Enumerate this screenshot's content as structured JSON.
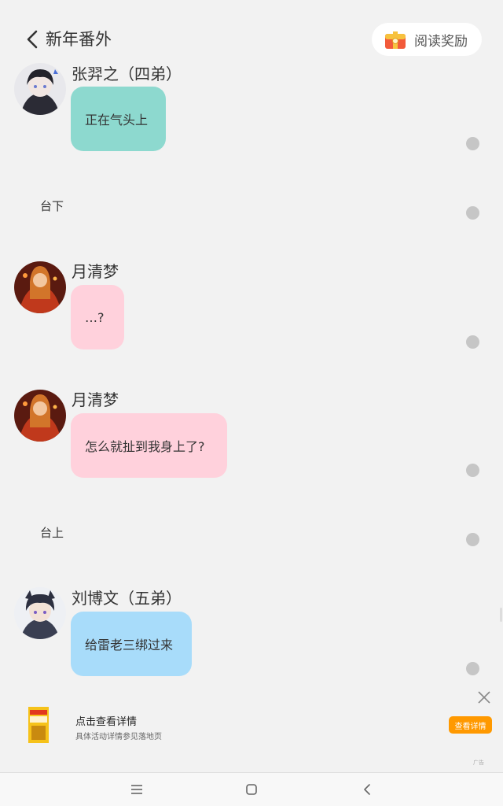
{
  "header": {
    "title": "新年番外",
    "reward_label": "阅读奖励"
  },
  "messages": [
    {
      "speaker": "张羿之（四弟）",
      "text": "正在气头上",
      "color": "#8dd9cf"
    },
    {
      "narration": "台下"
    },
    {
      "speaker": "月清梦",
      "text": "…?",
      "color": "#ffd1dc"
    },
    {
      "speaker": "月清梦",
      "text": "怎么就扯到我身上了?",
      "color": "#ffd1dc"
    },
    {
      "narration": "台上"
    },
    {
      "speaker": "刘博文（五弟）",
      "text": "给雷老三绑过来",
      "color": "#a8dcfa"
    }
  ],
  "ad": {
    "title": "点击查看详情",
    "description": "具体活动详情参见落地页",
    "button_label": "查看详情",
    "tag": "广告"
  },
  "nav": {
    "icons": [
      "menu-icon",
      "home-icon",
      "back-icon"
    ]
  }
}
